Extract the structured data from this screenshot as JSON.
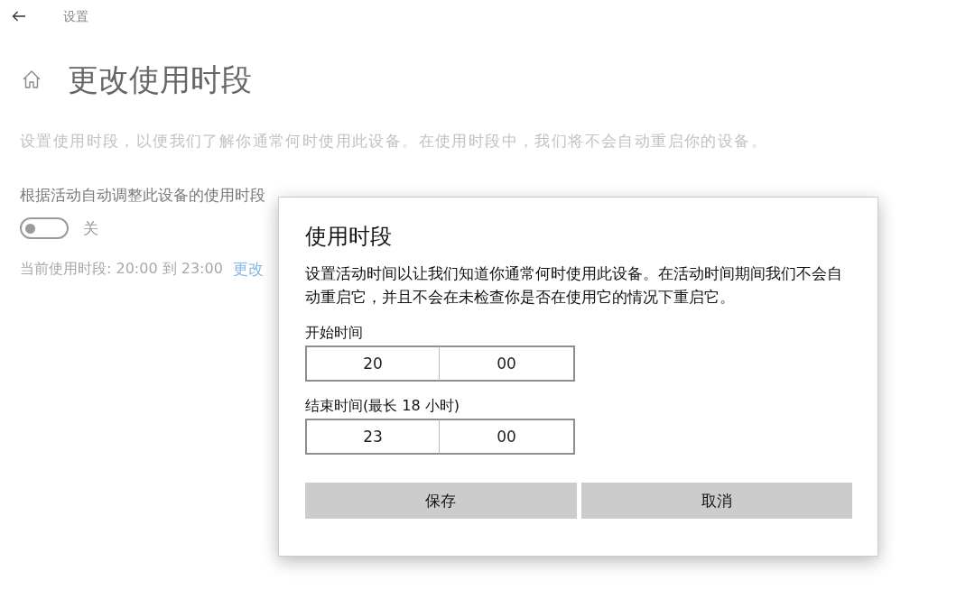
{
  "header": {
    "title": "设置"
  },
  "page": {
    "title": "更改使用时段",
    "description": "设置使用时段，以便我们了解你通常何时使用此设备。在使用时段中，我们将不会自动重启你的设备。",
    "auto_adjust": {
      "label": "根据活动自动调整此设备的使用时段",
      "on": false,
      "state_text": "关"
    },
    "current_hours": {
      "text": "当前使用时段: 20:00 到 23:00",
      "link": "更改"
    }
  },
  "dialog": {
    "title": "使用时段",
    "description": "设置活动时间以让我们知道你通常何时使用此设备。在活动时间期间我们不会自动重启它，并且不会在未检查你是否在使用它的情况下重启它。",
    "times": [
      {
        "label": "开始时间",
        "hour": "20",
        "minute": "00"
      },
      {
        "label": "结束时间(最长 18 小时)",
        "hour": "23",
        "minute": "00"
      }
    ],
    "buttons": [
      "保存",
      "取消"
    ]
  }
}
